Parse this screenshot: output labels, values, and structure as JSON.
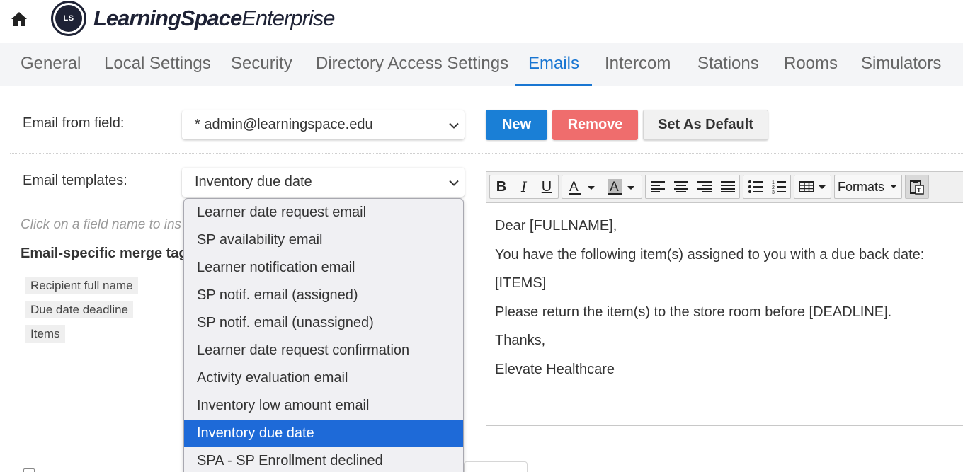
{
  "brand": {
    "mark_text": "LS",
    "name_bold": "LearningSpace",
    "name_regular": "Enterprise"
  },
  "tabs": [
    {
      "label": "General"
    },
    {
      "label": "Local Settings"
    },
    {
      "label": "Security"
    },
    {
      "label": "Directory Access Settings"
    },
    {
      "label": "Emails",
      "active": true
    },
    {
      "label": "Intercom"
    },
    {
      "label": "Stations"
    },
    {
      "label": "Rooms"
    },
    {
      "label": "Simulators"
    }
  ],
  "email_from": {
    "label": "Email from field:",
    "value": "* admin@learningspace.edu"
  },
  "buttons": {
    "new": "New",
    "remove": "Remove",
    "set_default": "Set As Default"
  },
  "email_templates": {
    "label": "Email templates:",
    "value": "Inventory due date",
    "options": [
      "Learner date request email",
      "SP availability email",
      "Learner notification email",
      "SP notif. email (assigned)",
      "SP notif. email (unassigned)",
      "Learner date request confirmation",
      "Activity evaluation email",
      "Inventory low amount email",
      "Inventory due date",
      "SPA - SP Enrollment declined"
    ],
    "selected_index": 8
  },
  "hint": "Click on a field name to ins",
  "merge_tags": {
    "title": "Email-specific merge tags",
    "tags": [
      "Recipient full name",
      "Due date deadline",
      "Items"
    ]
  },
  "editor": {
    "toolbar": {
      "formats_label": "Formats"
    },
    "body": [
      "Dear [FULLNAME],",
      "You have the following item(s) assigned to you with a due back date:",
      "[ITEMS]",
      "Please return the item(s) to the store room before [DEADLINE].",
      "Thanks,",
      "Elevate Healthcare"
    ]
  },
  "colors": {
    "accent": "#1a7fd6",
    "danger": "#ef6d6d",
    "selected": "#1e6ad8",
    "brand": "#1e2235"
  }
}
